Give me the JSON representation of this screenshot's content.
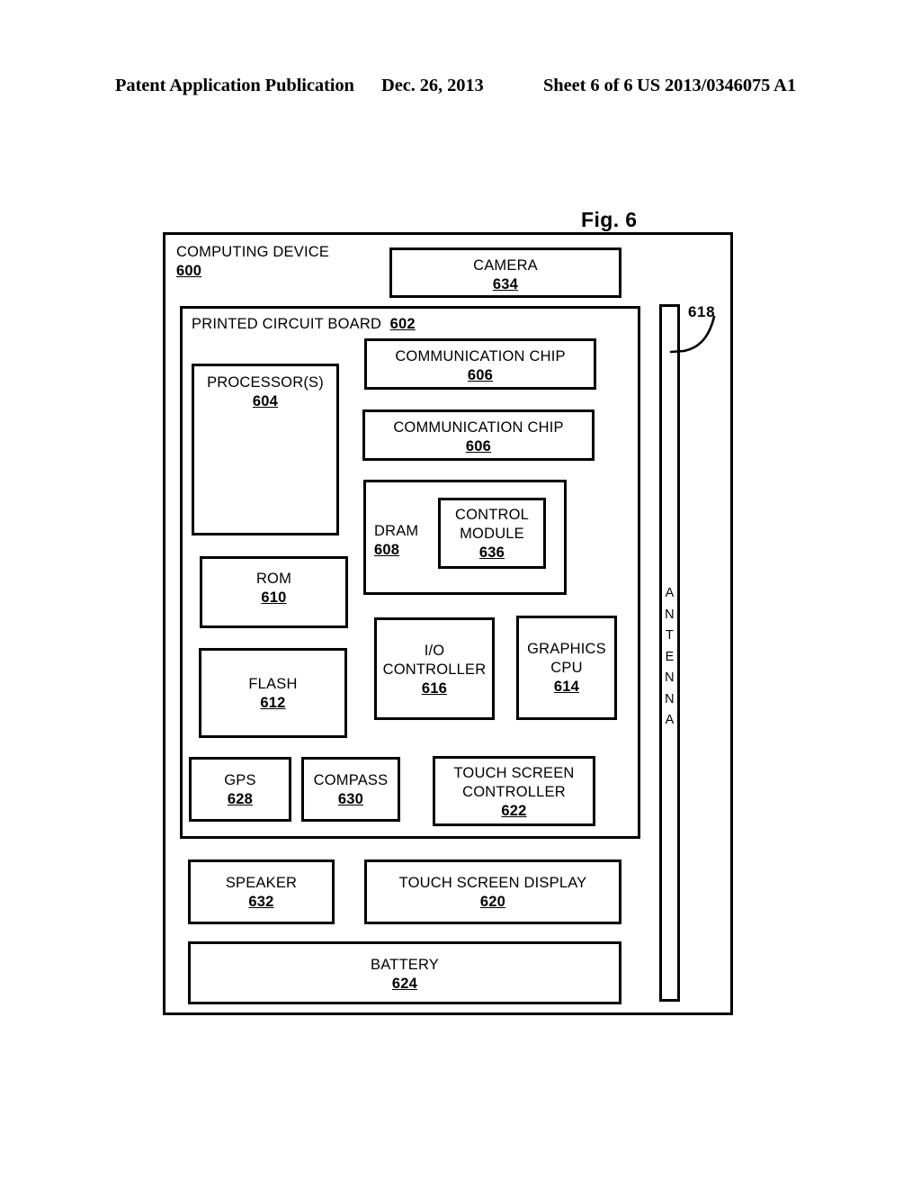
{
  "header": {
    "publication": "Patent Application Publication",
    "date": "Dec. 26, 2013",
    "sheet": "Sheet 6 of 6",
    "number": "US 2013/0346075 A1"
  },
  "figure": {
    "caption": "Fig. 6",
    "callout_618": "618"
  },
  "diagram": {
    "computing_device": {
      "title": "COMPUTING DEVICE",
      "ref": "600"
    },
    "camera": {
      "title": "CAMERA",
      "ref": "634"
    },
    "printed_circuit_board": {
      "title": "PRINTED CIRCUIT BOARD",
      "ref": "602"
    },
    "processor": {
      "title": "PROCESSOR(S)",
      "ref": "604"
    },
    "communication_chip_1": {
      "title": "COMMUNICATION CHIP",
      "ref": "606"
    },
    "communication_chip_2": {
      "title": "COMMUNICATION CHIP",
      "ref": "606"
    },
    "dram": {
      "title": "DRAM",
      "ref": "608"
    },
    "control_module": {
      "title_line1": "CONTROL",
      "title_line2": "MODULE",
      "ref": "636"
    },
    "rom": {
      "title": "ROM",
      "ref": "610"
    },
    "flash": {
      "title": "FLASH",
      "ref": "612"
    },
    "io_controller": {
      "title_line1": "I/O",
      "title_line2": "CONTROLLER",
      "ref": "616"
    },
    "graphics_cpu": {
      "title_line1": "GRAPHICS",
      "title_line2": "CPU",
      "ref": "614"
    },
    "gps": {
      "title": "GPS",
      "ref": "628"
    },
    "compass": {
      "title": "COMPASS",
      "ref": "630"
    },
    "touch_screen_controller": {
      "title_line1": "TOUCH SCREEN",
      "title_line2": "CONTROLLER",
      "ref": "622"
    },
    "speaker": {
      "title": "SPEAKER",
      "ref": "632"
    },
    "touch_screen_display": {
      "title": "TOUCH SCREEN DISPLAY",
      "ref": "620"
    },
    "battery": {
      "title": "BATTERY",
      "ref": "624"
    },
    "antenna": {
      "title": "ANTENNA",
      "letters": [
        "A",
        "N",
        "T",
        "E",
        "N",
        "N",
        "A"
      ],
      "ref": "618"
    }
  }
}
